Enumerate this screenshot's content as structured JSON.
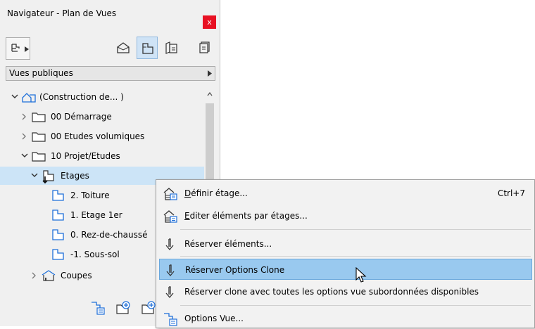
{
  "window": {
    "title": "Navigateur - Plan de Vues",
    "close_label": "x"
  },
  "toolbar": {
    "dropdown_icon": "view-map-icon",
    "view_buttons": [
      {
        "icon": "project-map-icon",
        "active": false
      },
      {
        "icon": "view-map-icon",
        "active": true
      },
      {
        "icon": "layout-book-icon",
        "active": false
      },
      {
        "icon": "publisher-sets-icon",
        "active": false
      }
    ]
  },
  "view_selector": {
    "label": "Vues publiques"
  },
  "tree": {
    "items": [
      {
        "label": "(Construction de... )",
        "icon": "project-icon",
        "expanded": true
      },
      {
        "label": "00 Démarrage",
        "icon": "folder-icon",
        "expanded": false
      },
      {
        "label": "00 Etudes volumiques",
        "icon": "folder-icon",
        "expanded": false
      },
      {
        "label": "10 Projet/Etudes",
        "icon": "folder-icon",
        "expanded": true
      },
      {
        "label": "Etages",
        "icon": "stories-icon",
        "expanded": true,
        "selected": true
      },
      {
        "label": "2. Toiture",
        "icon": "floor-plan-icon"
      },
      {
        "label": "1. Etage 1er",
        "icon": "floor-plan-icon"
      },
      {
        "label": "0. Rez-de-chaussé",
        "icon": "floor-plan-icon"
      },
      {
        "label": "-1. Sous-sol",
        "icon": "floor-plan-icon"
      },
      {
        "label": "Coupes",
        "icon": "sections-icon",
        "expanded": false
      }
    ]
  },
  "bottom_toolbar": {
    "icons": [
      "view-settings-icon",
      "new-folder-icon",
      "clone-folder-icon"
    ]
  },
  "context_menu": {
    "items": [
      {
        "label": "Définir étage...",
        "shortcut": "Ctrl+7",
        "icon": "story-settings-icon"
      },
      {
        "label": "Editer éléments par étages...",
        "shortcut": "",
        "icon": "story-settings-icon"
      },
      {
        "label": "Réserver éléments...",
        "shortcut": "",
        "icon": "reserve-arrow-icon"
      },
      {
        "label": "Réserver Options Clone",
        "shortcut": "",
        "icon": "reserve-arrow-icon",
        "highlighted": true
      },
      {
        "label": "Réserver clone avec toutes les options vue subordonnées disponibles",
        "shortcut": "",
        "icon": "reserve-arrow-icon"
      },
      {
        "label": "Options Vue...",
        "shortcut": "",
        "icon": "view-settings-icon"
      }
    ]
  },
  "colors": {
    "selection": "#cce4f7",
    "menu_highlight": "#99c9ef",
    "close_button": "#e81123",
    "icon_blue": "#1e6fd9"
  }
}
